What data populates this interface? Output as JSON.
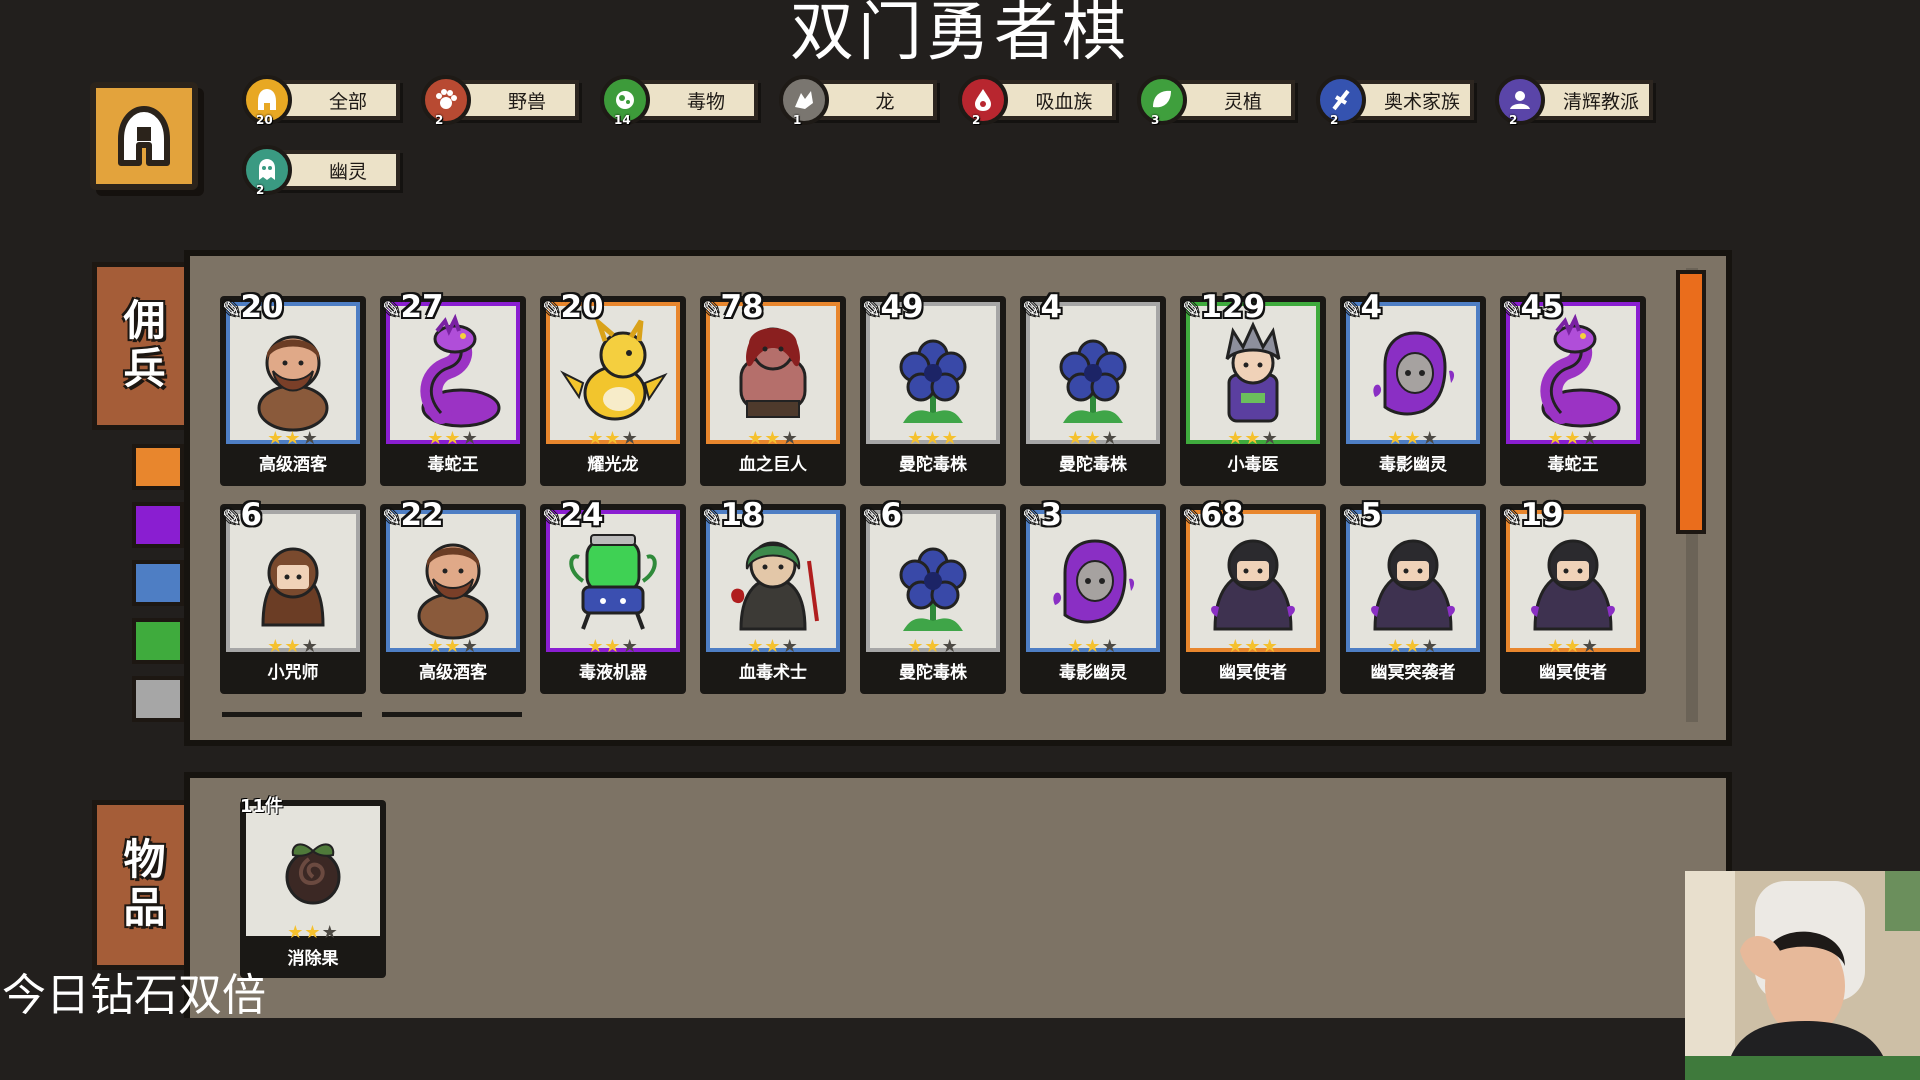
{
  "title": "双门勇者棋",
  "filters": [
    {
      "label": "全部",
      "count": "20",
      "icon": "helmet-icon",
      "color": "#e8a823"
    },
    {
      "label": "野兽",
      "count": "2",
      "icon": "paw-icon",
      "color": "#b84a32"
    },
    {
      "label": "毒物",
      "count": "14",
      "icon": "poison-icon",
      "color": "#3d9b3a"
    },
    {
      "label": "龙",
      "count": "1",
      "icon": "dragon-icon",
      "color": "#7a7670"
    },
    {
      "label": "吸血族",
      "count": "2",
      "icon": "blood-drop-icon",
      "color": "#b8262f"
    },
    {
      "label": "灵植",
      "count": "3",
      "icon": "leaf-icon",
      "color": "#3f9f3d"
    },
    {
      "label": "奥术家族",
      "count": "2",
      "icon": "arcane-icon",
      "color": "#3553b0"
    },
    {
      "label": "清辉教派",
      "count": "2",
      "icon": "cult-icon",
      "color": "#5a45a8"
    },
    {
      "label": "幽灵",
      "count": "2",
      "icon": "ghost-icon",
      "color": "#3a9a82"
    }
  ],
  "mercenary_tab_label": "佣兵",
  "items_tab_label": "物品",
  "rarity_colors": [
    "#e8862d",
    "#8a1ed1",
    "#4e7ec4",
    "#3fab3d",
    "#a6a6a6"
  ],
  "mercenaries": [
    {
      "name": "高级酒客",
      "cost": "20",
      "stars": 2,
      "rarity": "#4e7ec4",
      "art": "dwarf"
    },
    {
      "name": "毒蛇王",
      "cost": "27",
      "stars": 2,
      "rarity": "#8a1ed1",
      "art": "snake"
    },
    {
      "name": "耀光龙",
      "cost": "20",
      "stars": 2,
      "rarity": "#e8862d",
      "art": "dragon"
    },
    {
      "name": "血之巨人",
      "cost": "78",
      "stars": 2,
      "rarity": "#e8862d",
      "art": "giant"
    },
    {
      "name": "曼陀毒株",
      "cost": "49",
      "stars": 3,
      "rarity": "#a6a6a6",
      "art": "flower"
    },
    {
      "name": "曼陀毒株",
      "cost": "4",
      "stars": 2,
      "rarity": "#a6a6a6",
      "art": "flower"
    },
    {
      "name": "小毒医",
      "cost": "129",
      "stars": 2,
      "rarity": "#3fab3d",
      "art": "doctor"
    },
    {
      "name": "毒影幽灵",
      "cost": "4",
      "stars": 2,
      "rarity": "#4e7ec4",
      "art": "ghost"
    },
    {
      "name": "毒蛇王",
      "cost": "45",
      "stars": 2,
      "rarity": "#8a1ed1",
      "art": "snake"
    },
    {
      "name": "小咒师",
      "cost": "6",
      "stars": 2,
      "rarity": "#a6a6a6",
      "art": "hooded"
    },
    {
      "name": "高级酒客",
      "cost": "22",
      "stars": 2,
      "rarity": "#4e7ec4",
      "art": "dwarf"
    },
    {
      "name": "毒液机器",
      "cost": "24",
      "stars": 2,
      "rarity": "#8a1ed1",
      "art": "machine"
    },
    {
      "name": "血毒术士",
      "cost": "18",
      "stars": 2,
      "rarity": "#4e7ec4",
      "art": "warlock"
    },
    {
      "name": "曼陀毒株",
      "cost": "6",
      "stars": 2,
      "rarity": "#a6a6a6",
      "art": "flower"
    },
    {
      "name": "毒影幽灵",
      "cost": "3",
      "stars": 2,
      "rarity": "#4e7ec4",
      "art": "ghost"
    },
    {
      "name": "幽冥使者",
      "cost": "68",
      "stars": 3,
      "rarity": "#e8862d",
      "art": "reaper"
    },
    {
      "name": "幽冥突袭者",
      "cost": "5",
      "stars": 2,
      "rarity": "#4e7ec4",
      "art": "reaper"
    },
    {
      "name": "幽冥使者",
      "cost": "19",
      "stars": 2,
      "rarity": "#e8862d",
      "art": "reaper"
    }
  ],
  "items": [
    {
      "name": "消除果",
      "count": "11件",
      "stars": 2,
      "art": "fruit"
    }
  ],
  "overlay_text": "今日钻石双倍"
}
